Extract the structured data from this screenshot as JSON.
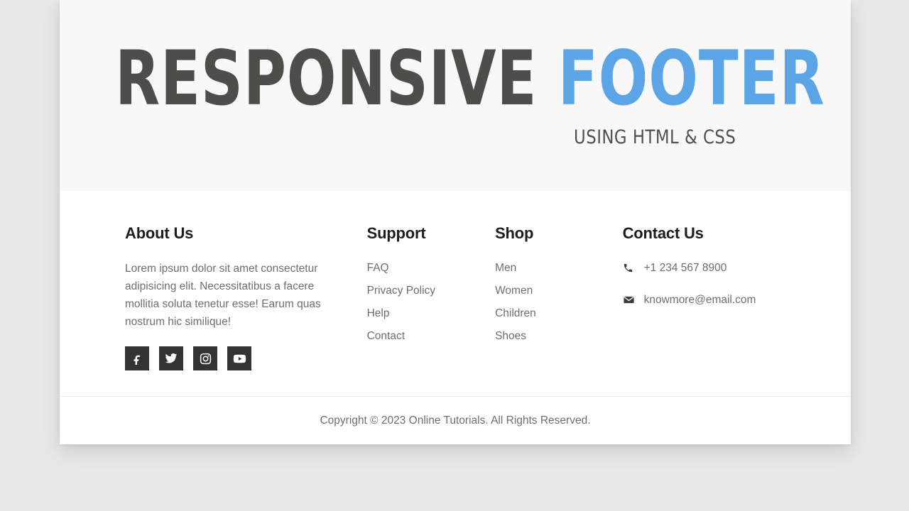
{
  "hero": {
    "title_dark": "RESPONSIVE",
    "title_accent": "FOOTER",
    "subtitle": "USING HTML & CSS",
    "accent_color": "#5ba4e5",
    "dark_color": "#4d4d4b",
    "band_color": "#f8f8f8"
  },
  "footer": {
    "about": {
      "heading": "About Us",
      "text": "Lorem ipsum dolor sit amet consectetur adipisicing elit. Necessitatibus a facere mollitia soluta tenetur esse! Earum quas nostrum hic similique!",
      "social": [
        {
          "name": "facebook",
          "label": "Facebook"
        },
        {
          "name": "twitter",
          "label": "Twitter"
        },
        {
          "name": "instagram",
          "label": "Instagram"
        },
        {
          "name": "youtube",
          "label": "YouTube"
        }
      ]
    },
    "support": {
      "heading": "Support",
      "links": [
        "FAQ",
        "Privacy Policy",
        "Help",
        "Contact"
      ]
    },
    "shop": {
      "heading": "Shop",
      "links": [
        "Men",
        "Women",
        "Children",
        "Shoes"
      ]
    },
    "contact": {
      "heading": "Contact Us",
      "phone": "+1 234 567 8900",
      "phone_icon": "phone-icon",
      "email": "knowmore@email.com",
      "email_icon": "envelope-icon"
    },
    "copyright": "Copyright © 2023 Online Tutorials. All Rights Reserved.",
    "social_button_color": "#333333",
    "link_color": "#6e6e6e",
    "heading_color": "#1d1d1d",
    "divider_color": "#ededed"
  },
  "page": {
    "background": "#e8e8e8",
    "card_background": "#ffffff"
  }
}
